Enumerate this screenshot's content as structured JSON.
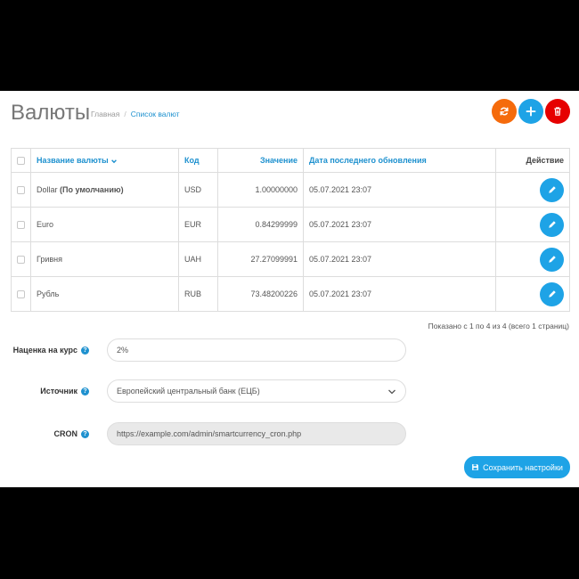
{
  "header": {
    "title": "Валюты",
    "breadcrumb": {
      "home": "Главная",
      "separator": "/",
      "current": "Список валют"
    }
  },
  "toolbar": {
    "refresh_icon": "refresh-icon",
    "add_icon": "plus-icon",
    "delete_icon": "trash-icon",
    "colors": {
      "refresh": "#f56b0c",
      "add": "#1ea3e6",
      "delete": "#e60000"
    }
  },
  "table": {
    "columns": {
      "name": "Название валюты",
      "code": "Код",
      "value": "Значение",
      "updated": "Дата последнего обновления",
      "action": "Действие"
    },
    "rows": [
      {
        "name": "Dollar",
        "default_note": "(По умолчанию)",
        "code": "USD",
        "value": "1.00000000",
        "updated": "05.07.2021 23:07"
      },
      {
        "name": "Euro",
        "default_note": "",
        "code": "EUR",
        "value": "0.84299999",
        "updated": "05.07.2021 23:07"
      },
      {
        "name": "Гривня",
        "default_note": "",
        "code": "UAH",
        "value": "27.27099991",
        "updated": "05.07.2021 23:07"
      },
      {
        "name": "Рубль",
        "default_note": "",
        "code": "RUB",
        "value": "73.48200226",
        "updated": "05.07.2021 23:07"
      }
    ]
  },
  "pagination": {
    "text": "Показано с 1 по 4 из 4 (всего 1 страниц)"
  },
  "settings": {
    "markup": {
      "label": "Наценка на курс",
      "value": "2%"
    },
    "source": {
      "label": "Источник",
      "value": "Европейский центральный банк (ЕЦБ)"
    },
    "cron": {
      "label": "CRON",
      "value": "https://example.com/admin/smartcurrency_cron.php"
    },
    "help_glyph": "?"
  },
  "save_button": {
    "label": "Сохранить настройки"
  }
}
